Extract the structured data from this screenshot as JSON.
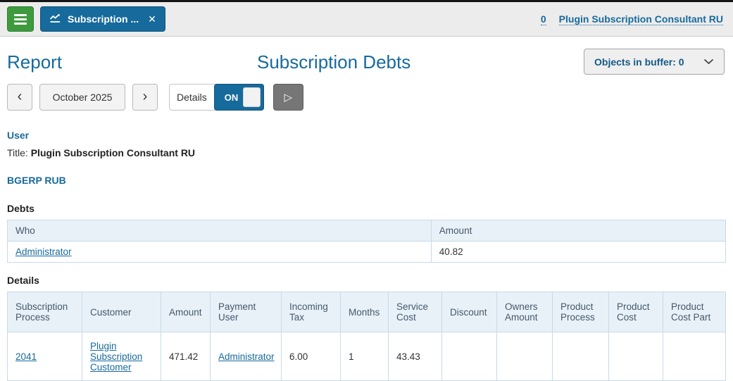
{
  "colors": {
    "accent_blue": "#176a9c",
    "menu_green": "#3d9b3d",
    "topbar_gray": "#ececec",
    "table_header_bg": "#e8f1f8",
    "table_border": "#c5dbe9",
    "run_button_gray": "#767676",
    "buffer_label_blue": "#155a86"
  },
  "topbar": {
    "tab": {
      "label": "Subscription ...",
      "close_glyph": "✕"
    },
    "buffer_count": "0",
    "user_name": "Plugin Subscription Consultant RU"
  },
  "header": {
    "page_title": "Report",
    "report_title": "Subscription Debts",
    "buffer_button_label": "Objects in buffer: 0"
  },
  "controls": {
    "prev_glyph": "‹",
    "period": "October 2025",
    "next_glyph": "›",
    "details_label": "Details",
    "toggle_state": "ON",
    "run_glyph": "▷"
  },
  "sections": {
    "user_heading": "User",
    "user_title_label": "Title:",
    "user_title_value": "Plugin Subscription Consultant RU",
    "currency_heading": "BGERP RUB",
    "debts_heading": "Debts",
    "details_heading": "Details"
  },
  "debts_table": {
    "columns": [
      "Who",
      "Amount"
    ],
    "rows": [
      {
        "who": "Administrator",
        "amount": "40.82"
      }
    ]
  },
  "details_table": {
    "columns": [
      "Subscription Process",
      "Customer",
      "Amount",
      "Payment User",
      "Incoming Tax",
      "Months",
      "Service Cost",
      "Discount",
      "Owners Amount",
      "Product Process",
      "Product Cost",
      "Product Cost Part"
    ],
    "rows": [
      {
        "subscription_process": "2041",
        "customer": "Plugin Subscription Customer",
        "amount": "471.42",
        "payment_user": "Administrator",
        "incoming_tax": "6.00",
        "months": "1",
        "service_cost": "43.43",
        "discount": "",
        "owners_amount": "",
        "product_process": "",
        "product_cost": "",
        "product_cost_part": ""
      }
    ]
  }
}
